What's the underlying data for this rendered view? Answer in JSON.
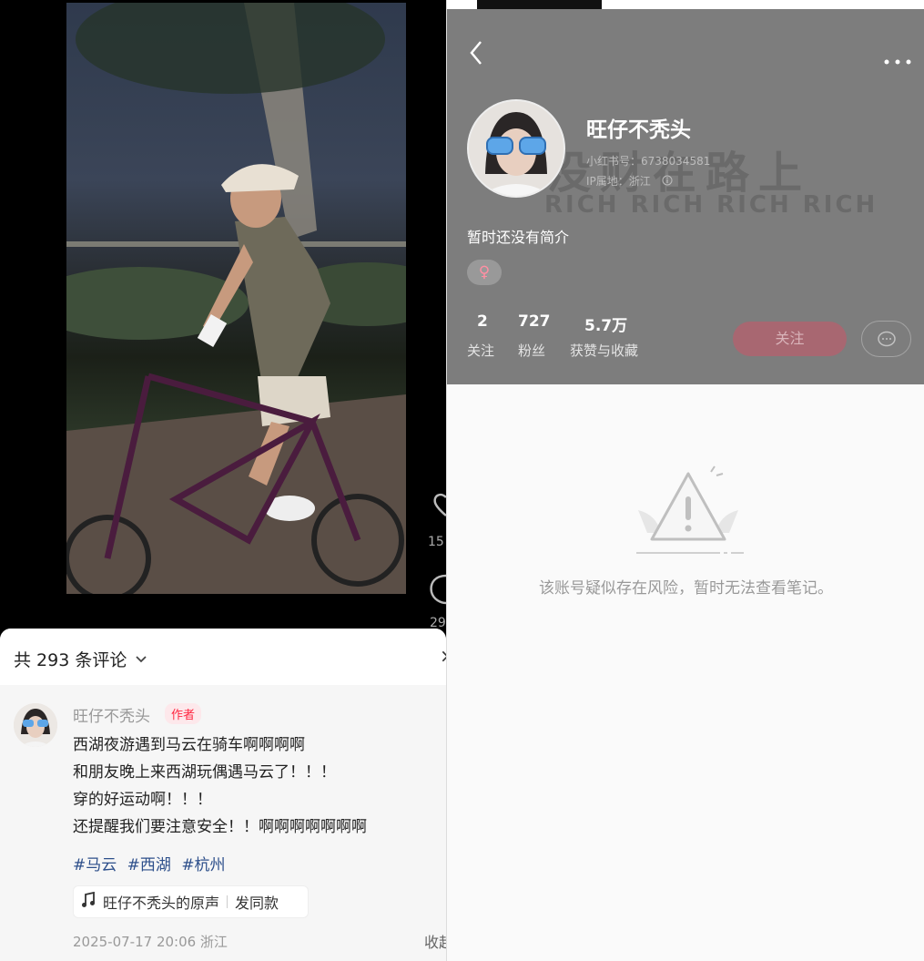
{
  "left": {
    "likes_count": "15",
    "comments_count": "29",
    "comments_header": "共 293 条评论",
    "close_label": "×",
    "comment": {
      "user": "旺仔不秃头",
      "badge": "作者",
      "lines": [
        "西湖夜游遇到马云在骑车啊啊啊啊",
        "和朋友晚上来西湖玩偶遇马云了！！！",
        "穿的好运动啊！！！",
        "还提醒我们要注意安全！！啊啊啊啊啊啊啊"
      ],
      "tags": [
        "#马云",
        "#西湖",
        "#杭州"
      ],
      "music": {
        "name": "旺仔不秃头的原声",
        "action": "发同款"
      },
      "date": "2025-07-17 20:06 浙江",
      "collapse": "收起"
    }
  },
  "profile": {
    "name": "旺仔不秃头",
    "id_line": "小红书号：6738034581",
    "ip_line": "IP属地：浙江",
    "bg_text_1": "没财在路上",
    "bg_text_2": "RICH RICH RICH RICH",
    "bio": "暂时还没有简介",
    "gender_symbol": "♀",
    "stats": [
      {
        "value": "2",
        "label": "关注"
      },
      {
        "value": "727",
        "label": "粉丝"
      },
      {
        "value": "5.7万",
        "label": "获赞与收藏"
      }
    ],
    "follow_label": "关注",
    "empty_message": "该账号疑似存在风险，暂时无法查看笔记。"
  },
  "colors": {
    "accent": "#ff2741",
    "tag": "#2d4f8b",
    "header_bg": "#7d7d7d"
  }
}
